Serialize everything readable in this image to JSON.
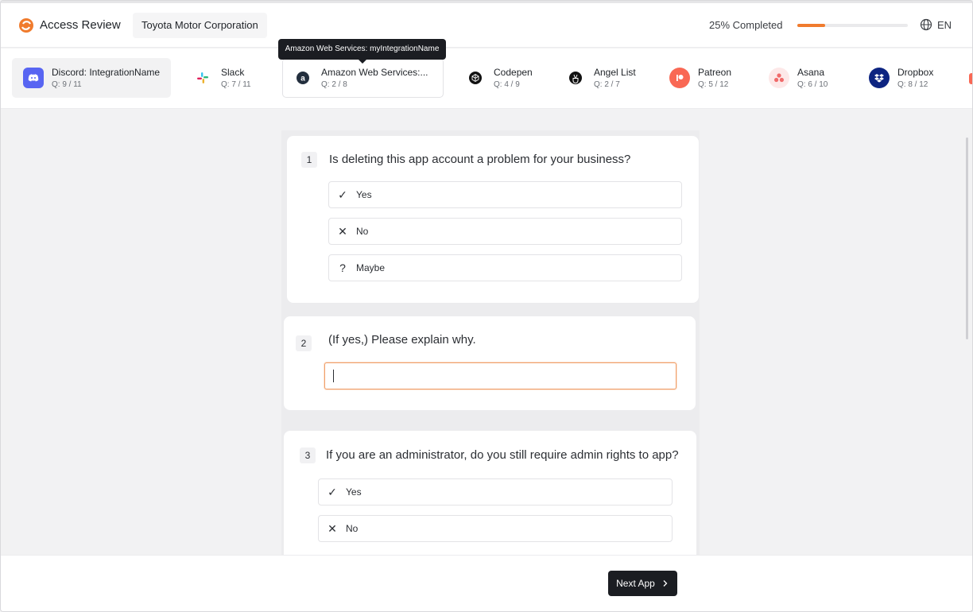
{
  "header": {
    "app_title": "Access Review",
    "organization": "Toyota Motor Corporation",
    "progress_label": "25% Completed",
    "progress_fraction": 0.25,
    "language": "EN",
    "icons": {
      "logo": "app-logo-icon",
      "language": "globe-icon"
    }
  },
  "apps": [
    {
      "name": "Discord: IntegrationName",
      "questions": "Q: 9 / 11",
      "icon": "discord-icon",
      "color": "#5865F2",
      "state": "active"
    },
    {
      "name": "Slack",
      "questions": "Q: 7 / 11",
      "icon": "slack-icon",
      "color": "#E01E5A"
    },
    {
      "name": "Amazon Web Services:...",
      "questions": "Q: 2 / 8",
      "icon": "amazon-icon",
      "color": "#232F3E",
      "state": "hover"
    },
    {
      "name": "Codepen",
      "questions": "Q: 4 / 9",
      "icon": "codepen-icon",
      "color": "#111111"
    },
    {
      "name": "Angel List",
      "questions": "Q: 2 / 7",
      "icon": "angellist-icon",
      "color": "#111111"
    },
    {
      "name": "Patreon",
      "questions": "Q: 5 / 12",
      "icon": "patreon-icon",
      "color": "#F96854"
    },
    {
      "name": "Asana",
      "questions": "Q: 6 / 10",
      "icon": "asana-icon",
      "color": "#F06A6A"
    },
    {
      "name": "Dropbox",
      "questions": "Q: 8 / 12",
      "icon": "dropbox-icon",
      "color": "#0D2481"
    }
  ],
  "tooltip": "Amazon Web Services: myIntegrationName",
  "questions": [
    {
      "number": "1",
      "text": "Is deleting this app account a problem for your business?",
      "options": [
        {
          "label": "Yes",
          "icon": "check-icon"
        },
        {
          "label": "No",
          "icon": "x-icon"
        },
        {
          "label": "Maybe",
          "icon": "question-icon"
        }
      ]
    },
    {
      "number": "2",
      "text": "(If yes,) Please explain why.",
      "answer_value": ""
    },
    {
      "number": "3",
      "text": "If you are an administrator, do you still require admin rights to app?",
      "options": [
        {
          "label": "Yes",
          "icon": "check-icon"
        },
        {
          "label": "No",
          "icon": "x-icon"
        }
      ]
    }
  ],
  "footer": {
    "next_label": "Next App",
    "next_icon": "chevron-right-icon"
  },
  "colors": {
    "accent": "#f07b2d",
    "dark": "#1b1d22"
  }
}
